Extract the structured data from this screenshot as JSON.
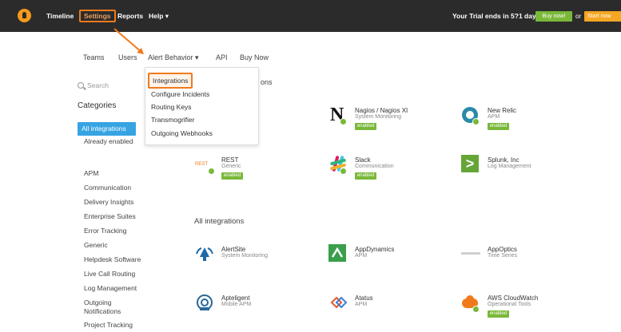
{
  "topbar": {
    "nav": [
      "Timeline",
      "Settings",
      "Reports",
      "Help ▾"
    ],
    "trial_text": "Your Trial ends in 5?1 days",
    "buy_now": "Buy now!",
    "or": "or",
    "start_button": "Start now"
  },
  "subnav": {
    "teams": "Teams",
    "users": "Users",
    "alert_behavior": "Alert Behavior ▾",
    "api": "API",
    "buy_now": "Buy Now"
  },
  "dropdown": {
    "items": [
      "Integrations",
      "Configure Incidents",
      "Routing Keys",
      "Transmogrifier",
      "Outgoing Webhooks"
    ]
  },
  "sidebar": {
    "search_placeholder": "Search",
    "categories_title": "Categories",
    "all_integrations": "All integrations",
    "already_enabled": "Already enabled",
    "categories": [
      "APM",
      "Communication",
      "Delivery Insights",
      "Enterprise Suites",
      "Error Tracking",
      "Generic",
      "Helpdesk Software",
      "Live Call Routing",
      "Log Management",
      "Outgoing Notifications",
      "Project Tracking"
    ]
  },
  "popular": {
    "title_fragment": "ons",
    "cards": [
      {
        "name": "Nagios / Nagios XI",
        "category": "System Monitoring",
        "badge": "enabled"
      },
      {
        "name": "New Relic",
        "category": "APM",
        "badge": "enabled"
      },
      {
        "name": "REST",
        "category": "Generic",
        "badge": "enabled"
      },
      {
        "name": "Slack",
        "category": "Communication",
        "badge": "enabled"
      },
      {
        "name": "Splunk, Inc",
        "category": "Log Management",
        "badge": ""
      }
    ]
  },
  "all_integrations": {
    "title": "All integrations",
    "cards": [
      {
        "name": "AlertSite",
        "category": "System Monitoring",
        "badge": ""
      },
      {
        "name": "AppDynamics",
        "category": "APM",
        "badge": ""
      },
      {
        "name": "AppOptics",
        "category": "Time Series",
        "badge": ""
      },
      {
        "name": "Apteligent",
        "category": "Mobile APM",
        "badge": ""
      },
      {
        "name": "Atatus",
        "category": "APM",
        "badge": ""
      },
      {
        "name": "AWS CloudWatch",
        "category": "Operational Tools",
        "badge": "enabled"
      }
    ]
  },
  "colors": {
    "topbar": "#2b2b2b",
    "accent_orange": "#f07a1a",
    "brand_blue": "#36a4e3",
    "enabled_green": "#7ab83a"
  }
}
